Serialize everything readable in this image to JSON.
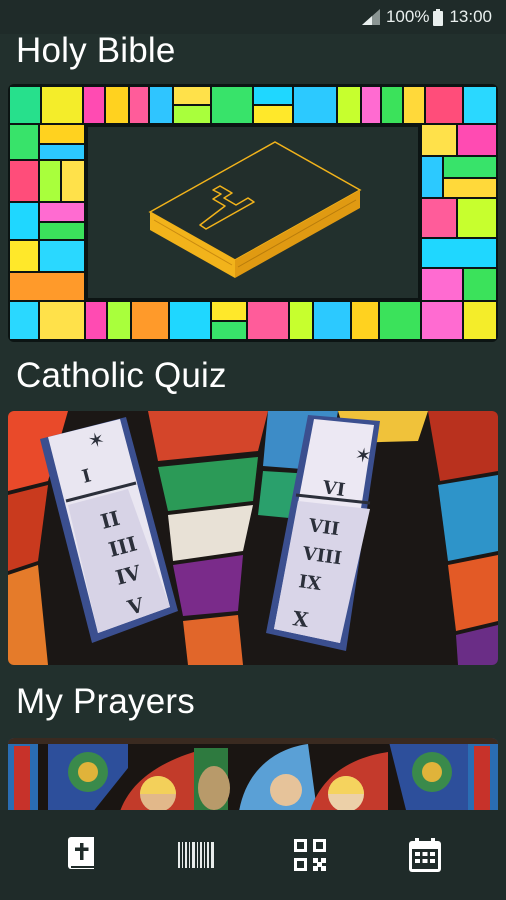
{
  "status_bar": {
    "battery_percent": "100%",
    "time": "13:00",
    "icons": [
      "signal-icon",
      "battery-icon"
    ]
  },
  "sections": [
    {
      "title": "Holy Bible",
      "image": "stained-glass-bible-image"
    },
    {
      "title": "Catholic Quiz",
      "image": "ten-commandments-tablets-image"
    },
    {
      "title": "My Prayers",
      "image": "stained-glass-saints-image"
    }
  ],
  "tablets": {
    "left": [
      "I",
      "II",
      "III",
      "IV",
      "V"
    ],
    "right": [
      "VI",
      "VII",
      "VIII",
      "IX",
      "X"
    ]
  },
  "bottom_nav": {
    "items": [
      "bible-icon",
      "barcode-icon",
      "qr-code-icon",
      "calendar-icon"
    ]
  },
  "colors": {
    "background": "#22302d",
    "bars": "#1f2b29",
    "bible_cover": "#222e2b",
    "bible_pages": "#f2b31b"
  }
}
